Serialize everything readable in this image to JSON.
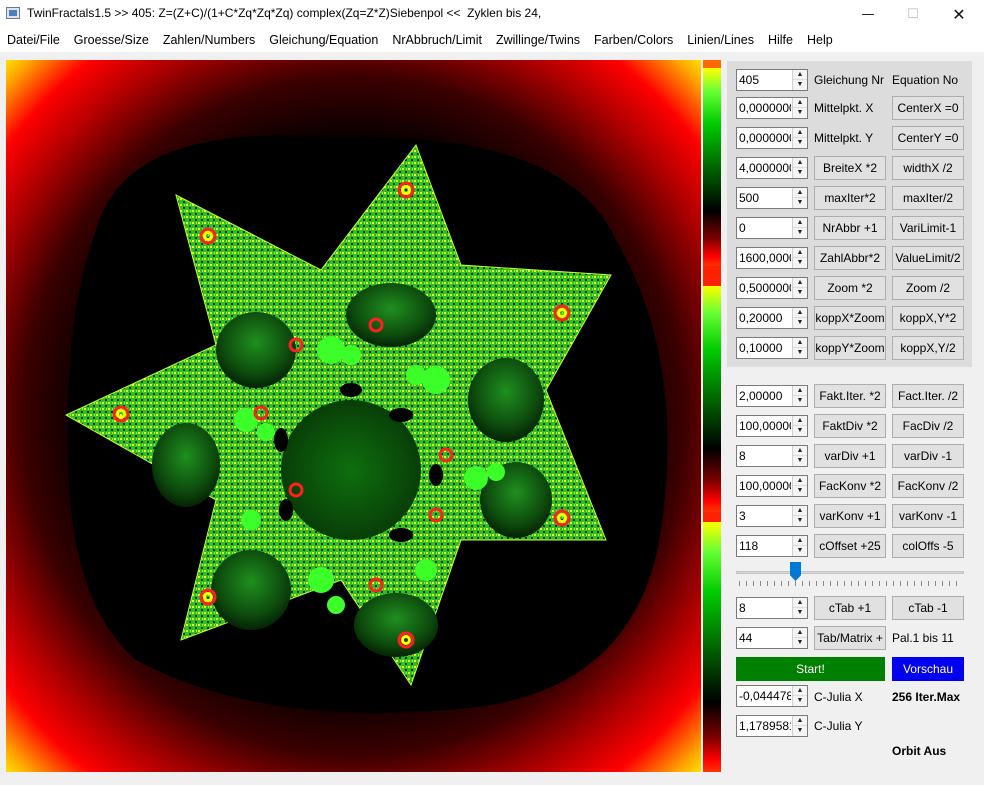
{
  "window": {
    "title": "TwinFractals1.5 >> 405: Z=(Z+C)/(1+C*Zq*Zq*Zq) complex(Zq=Z*Z)Siebenpol <<  Zyklen bis 24,",
    "minimize_glyph": "—",
    "maximize_glyph": "☐",
    "close_glyph": "✕"
  },
  "menu": [
    "Datei/File",
    "Groesse/Size",
    "Zahlen/Numbers",
    "Gleichung/Equation",
    "NrAbbruch/Limit",
    "Zwillinge/Twins",
    "Farben/Colors",
    "Linien/Lines",
    "Hilfe",
    "Help"
  ],
  "panel_top": {
    "rows": [
      {
        "value": "405",
        "label1": "Gleichung Nr",
        "label2": "Equation No"
      },
      {
        "value": "0,00000000",
        "label1": "Mittelpkt. X",
        "button2": "CenterX =0"
      },
      {
        "value": "0,00000000",
        "label1": "Mittelpkt. Y",
        "button2": "CenterY =0"
      },
      {
        "value": "4,0000000",
        "button1": "BreiteX *2",
        "button2": "widthX /2"
      },
      {
        "value": "500",
        "button1": "maxIter*2",
        "button2": "maxIter/2"
      },
      {
        "value": "0",
        "button1": "NrAbbr +1",
        "button2": "VariLimit-1"
      },
      {
        "value": "1600,0000",
        "button1": "ZahlAbbr*2",
        "button2": "ValueLimit/2"
      },
      {
        "value": "0,5000000",
        "button1": "Zoom *2",
        "button2": "Zoom /2"
      },
      {
        "value": "0,20000",
        "button1": "koppX*Zoom",
        "button2": "koppX,Y*2"
      },
      {
        "value": "0,10000",
        "button1": "koppY*Zoom",
        "button2": "koppX,Y/2"
      }
    ]
  },
  "panel_bottom": {
    "rows": [
      {
        "value": "2,00000",
        "button1": "Fakt.Iter. *2",
        "button2": "Fact.Iter. /2"
      },
      {
        "value": "100,00000",
        "button1": "FaktDiv *2",
        "button2": "FacDiv /2"
      },
      {
        "value": "8",
        "button1": "varDiv +1",
        "button2": "varDiv -1"
      },
      {
        "value": "100,00000",
        "button1": "FacKonv *2",
        "button2": "FacKonv /2"
      },
      {
        "value": "3",
        "button1": "varKonv +1",
        "button2": "varKonv -1"
      },
      {
        "value": "118",
        "button1": "cOffset +25",
        "button2": "colOffs -5"
      }
    ],
    "slider_position_fraction": 0.25,
    "ctab": {
      "value": "8",
      "button1": "cTab +1",
      "button2": "cTab -1"
    },
    "matrix": {
      "value": "44",
      "button1": "Tab/Matrix +",
      "label": "Pal.1 bis 11"
    },
    "start": "Start!",
    "preview": "Vorschau",
    "julia_x": {
      "value": "-0,0444784",
      "label": "C-Julia X"
    },
    "julia_y": {
      "value": "1,1789581",
      "label": "C-Julia Y"
    },
    "iter_max": "256 Iter.Max",
    "orbit": "Orbit Aus"
  },
  "colors": {
    "start_green": "#008000",
    "preview_blue": "#0000ee",
    "fractal_green": "#33ff33",
    "fractal_yellow": "#ffff00",
    "fractal_red": "#ff0000"
  }
}
